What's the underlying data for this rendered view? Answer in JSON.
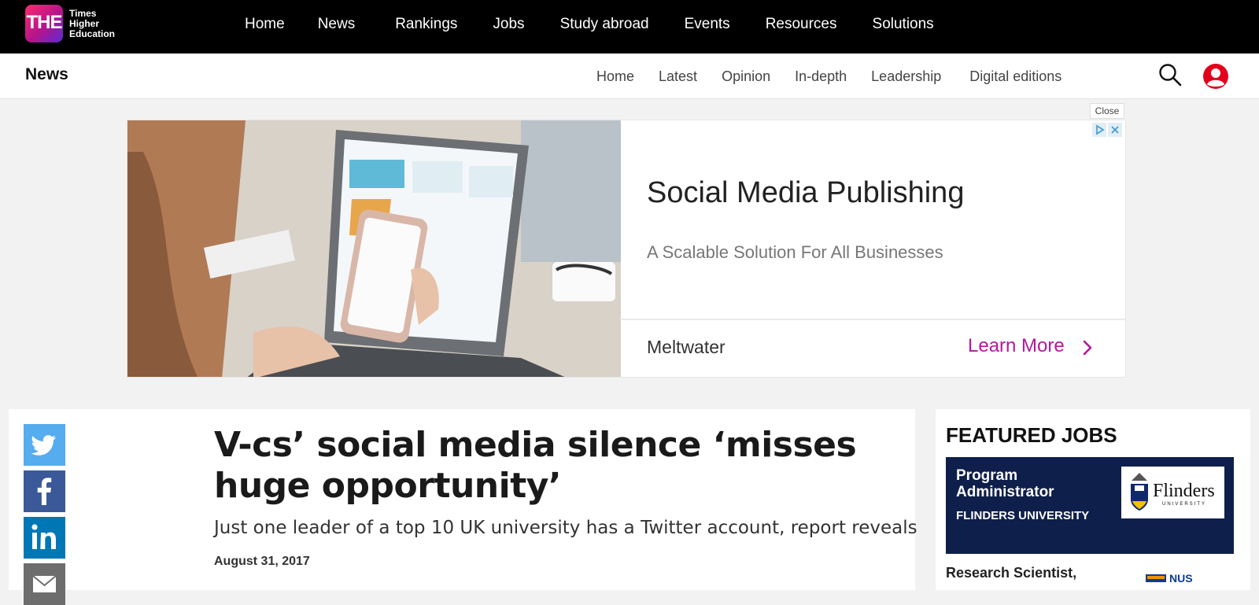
{
  "brand": {
    "logo_text": "THE",
    "name_line1": "Times",
    "name_line2": "Higher",
    "name_line3": "Education"
  },
  "top_nav": [
    "Home",
    "News",
    "Rankings",
    "Jobs",
    "Study abroad",
    "Events",
    "Resources",
    "Solutions"
  ],
  "sub_header": {
    "section": "News",
    "nav": [
      "Home",
      "Latest",
      "Opinion",
      "In-depth",
      "Leadership",
      "Digital editions"
    ]
  },
  "ad": {
    "close_label": "Close",
    "headline": "Social Media Publishing",
    "subtext": "A Scalable Solution For All Businesses",
    "advertiser": "Meltwater",
    "cta": "Learn More",
    "cta_color": "#b5179e"
  },
  "article": {
    "headline": "V-cs’ social media silence ‘misses huge opportunity’",
    "standfirst": "Just one leader of a top 10 UK university has a Twitter account, report reveals",
    "date": "August 31, 2017",
    "share_icons": [
      "twitter-icon",
      "facebook-icon",
      "linkedin-icon",
      "email-icon"
    ]
  },
  "featured_jobs": {
    "title": "FEATURED JOBS",
    "jobs": [
      {
        "title": "Program Administrator",
        "employer": "FLINDERS UNIVERSITY",
        "logo_text": "Flinders",
        "logo_subtext": "UNIVERSITY"
      },
      {
        "title": "Research Scientist,",
        "logo_text": "NUS"
      }
    ]
  },
  "colors": {
    "top_bar": "#000000",
    "twitter": "#55acee",
    "facebook": "#3b5998",
    "linkedin": "#0077b5",
    "email": "#6d6d6d",
    "user_icon": "#e3001b",
    "job_card": "#0f1f4b"
  }
}
